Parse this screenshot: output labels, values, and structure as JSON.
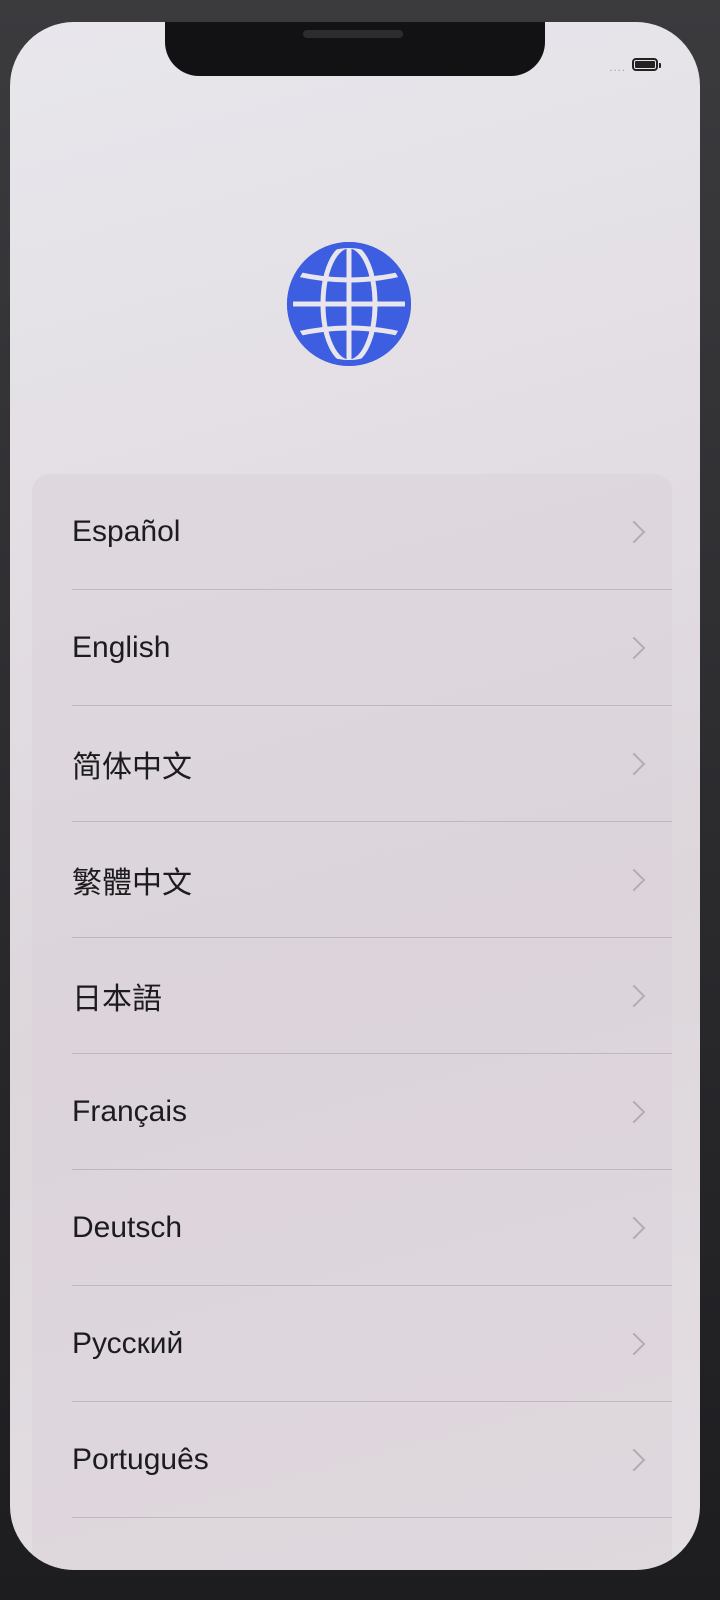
{
  "status_bar": {
    "signal_text": "····",
    "battery_icon": "battery-icon"
  },
  "header": {
    "icon": "globe-icon",
    "icon_color": "#3d5ee0"
  },
  "languages": [
    {
      "label": "Español"
    },
    {
      "label": "English"
    },
    {
      "label": "简体中文"
    },
    {
      "label": "繁體中文"
    },
    {
      "label": "日本語"
    },
    {
      "label": "Français"
    },
    {
      "label": "Deutsch"
    },
    {
      "label": "Русский"
    },
    {
      "label": "Português"
    }
  ]
}
